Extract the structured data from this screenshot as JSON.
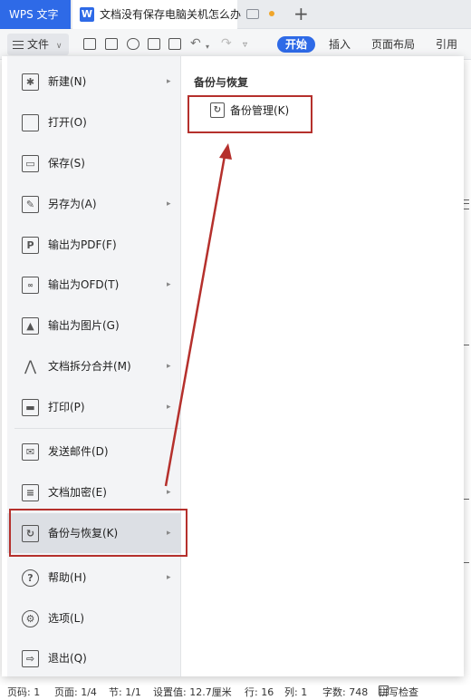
{
  "tabs": {
    "app_tab": "WPS 文字",
    "doc_icon": "W",
    "doc_title": "文档没有保存电脑关机怎么办"
  },
  "toolbar": {
    "file_label": "文件",
    "ribbon": [
      "开始",
      "插入",
      "页面布局",
      "引用"
    ],
    "accent_color": "#2e6ae7"
  },
  "file_menu": {
    "items": [
      {
        "label": "新建(N)",
        "icon": "new-document-icon",
        "submenu": true
      },
      {
        "label": "打开(O)",
        "icon": "open-folder-icon",
        "submenu": false
      },
      {
        "label": "保存(S)",
        "icon": "save-icon",
        "submenu": false
      },
      {
        "label": "另存为(A)",
        "icon": "save-as-icon",
        "submenu": true
      },
      {
        "label": "输出为PDF(F)",
        "icon": "export-pdf-icon",
        "submenu": false
      },
      {
        "label": "输出为OFD(T)",
        "icon": "export-ofd-icon",
        "submenu": true
      },
      {
        "label": "输出为图片(G)",
        "icon": "export-image-icon",
        "submenu": false
      },
      {
        "label": "文档拆分合并(M)",
        "icon": "split-merge-icon",
        "submenu": true
      },
      {
        "label": "打印(P)",
        "icon": "printer-icon",
        "submenu": true
      },
      {
        "label": "发送邮件(D)",
        "icon": "mail-icon",
        "submenu": false
      },
      {
        "label": "文档加密(E)",
        "icon": "encrypt-document-icon",
        "submenu": true
      },
      {
        "label": "备份与恢复(K)",
        "icon": "backup-restore-icon",
        "submenu": true
      },
      {
        "label": "帮助(H)",
        "icon": "help-icon",
        "submenu": true
      },
      {
        "label": "选项(L)",
        "icon": "gear-icon",
        "submenu": false
      },
      {
        "label": "退出(Q)",
        "icon": "exit-icon",
        "submenu": false
      }
    ],
    "highlighted": "备份与恢复(K)"
  },
  "submenu": {
    "title": "备份与恢复",
    "items": [
      {
        "label": "备份管理(K)",
        "icon": "backup-manage-icon"
      }
    ]
  },
  "annotation": {
    "color": "#b5302c"
  },
  "statusbar": {
    "page": "页码: 1",
    "pages": "页面: 1/4",
    "section": "节: 1/1",
    "setting": "设置值: 12.7厘米",
    "row": "行: 16",
    "col": "列: 1",
    "words": "字数: 748",
    "spellcheck": "拼写检查"
  }
}
